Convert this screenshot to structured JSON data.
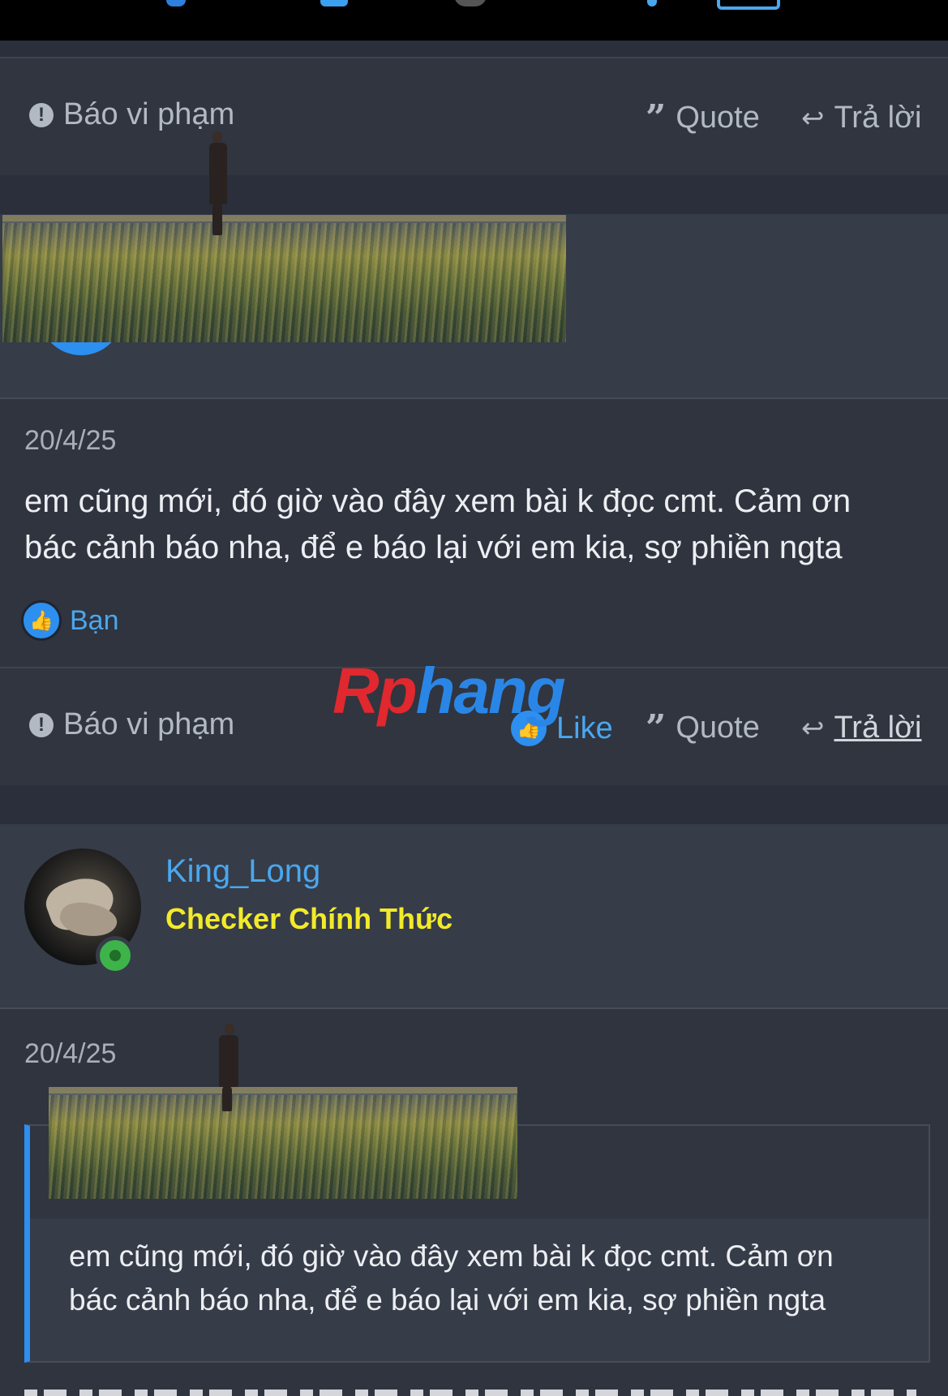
{
  "post1": {
    "report_label": "Báo vi phạm",
    "quote_label": "Quote",
    "reply_label": "Trả lời"
  },
  "post2": {
    "date": "20/4/25",
    "text_line1": "em cũng mới, đó giờ vào đây xem bài k đọc cmt. Cảm ơn",
    "text_line2": "bác cảnh báo nha, để e báo lại với em kia, sợ phiền ngta",
    "reaction_label": "Bạn",
    "report_label": "Báo vi phạm",
    "like_label": "Like",
    "quote_label": "Quote",
    "reply_label": "Trả lời"
  },
  "watermark": {
    "part1": "Rp",
    "part2": "hang"
  },
  "post3": {
    "username": "King_Long",
    "user_title": "Checker Chính Thức",
    "date": "20/4/25",
    "quote_line1": "em cũng mới, đó giờ vào đây xem bài k đọc cmt. Cảm ơn",
    "quote_line2": "bác cảnh báo nha, để e báo lại với em kia, sợ phiền ngta"
  },
  "icons": {
    "report": "exclamation-circle-icon",
    "quote": "quote-icon",
    "reply": "reply-arrow-icon",
    "like": "thumbs-up-icon",
    "online": "online-status-icon"
  },
  "colors": {
    "accent_blue": "#4aa7ee",
    "user_title_yellow": "#f2ea2a",
    "online_green": "#3db34a",
    "like_blue": "#2d8ff0"
  }
}
